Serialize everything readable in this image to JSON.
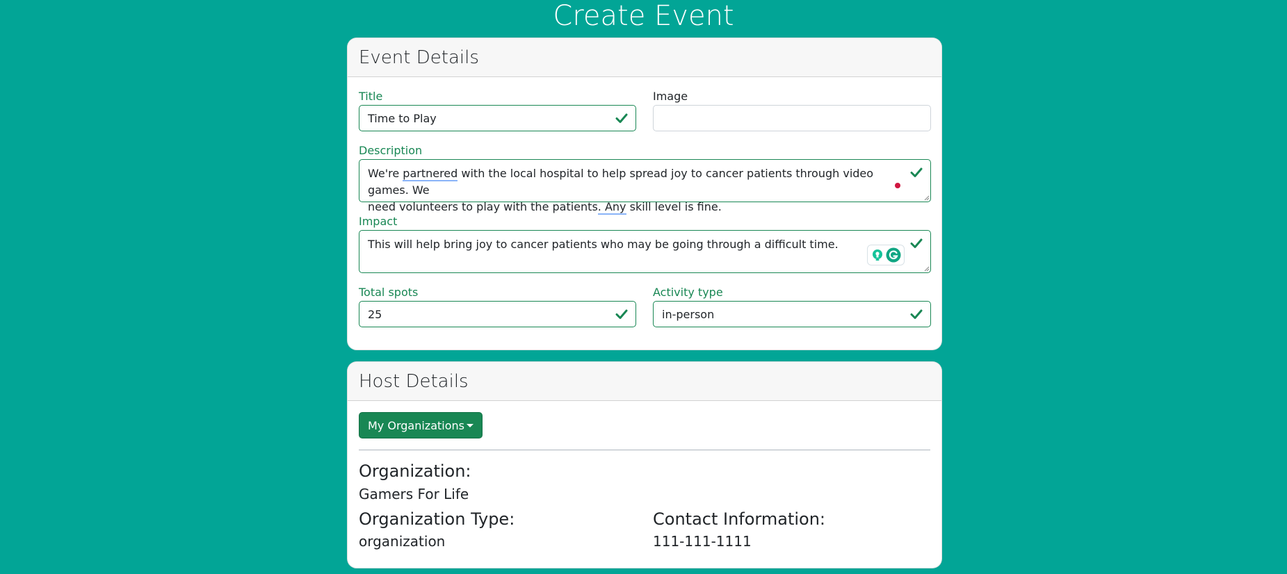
{
  "page": {
    "title": "Create Event"
  },
  "event_details": {
    "header": "Event Details",
    "title": {
      "label": "Title",
      "value": "Time to Play"
    },
    "image": {
      "label": "Image",
      "value": ""
    },
    "description": {
      "label": "Description",
      "line1_a": "We're ",
      "line1_b": "partnered",
      "line1_c": " with the local hospital to help spread joy to cancer patients through video games. We",
      "line2_a": "need volunteers to play with the patients",
      "line2_b": ". Any",
      "line2_c": " skill level is fine."
    },
    "impact": {
      "label": "Impact",
      "value": "This will help bring joy to cancer patients who may be going through a difficult time."
    },
    "total_spots": {
      "label": "Total spots",
      "value": "25"
    },
    "activity_type": {
      "label": "Activity type",
      "value": "in-person"
    }
  },
  "host_details": {
    "header": "Host Details",
    "orgs_button": "My Organizations",
    "organization_label": "Organization:",
    "organization_value": "Gamers For Life",
    "org_type_label": "Organization Type:",
    "org_type_value": "organization",
    "contact_label": "Contact Information:",
    "contact_value": "111-111-1111"
  },
  "colors": {
    "background": "#02a596",
    "valid": "#198754",
    "button": "#198754"
  }
}
